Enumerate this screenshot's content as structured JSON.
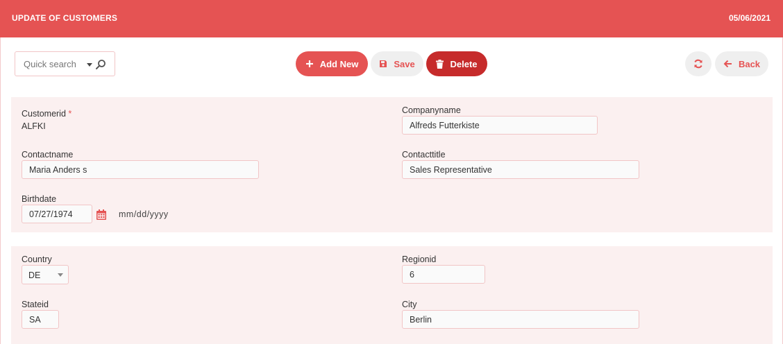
{
  "header": {
    "title": "UPDATE OF CUSTOMERS",
    "date": "05/06/2021"
  },
  "toolbar": {
    "search_placeholder": "Quick search",
    "add_label": "Add New",
    "save_label": "Save",
    "delete_label": "Delete",
    "back_label": "Back"
  },
  "colors": {
    "accent": "#e55353",
    "delete": "#c62b2b",
    "panel": "#fbf0f0"
  },
  "icons": {
    "search": "search-icon",
    "add": "plus-icon",
    "save": "floppy-disk-icon",
    "delete": "trash-icon",
    "refresh": "refresh-icon",
    "back": "arrow-left-icon",
    "calendar": "calendar-icon"
  },
  "form": {
    "customerid": {
      "label": "Customerid",
      "required_mark": "*",
      "value": "ALFKI"
    },
    "companyname": {
      "label": "Companyname",
      "value": "Alfreds Futterkiste"
    },
    "contactname": {
      "label": "Contactname",
      "value": "Maria Anders s"
    },
    "contacttitle": {
      "label": "Contacttitle",
      "value": "Sales Representative"
    },
    "birthdate": {
      "label": "Birthdate",
      "value": "07/27/1974",
      "format_hint": "mm/dd/yyyy"
    },
    "country": {
      "label": "Country",
      "value": "DE"
    },
    "regionid": {
      "label": "Regionid",
      "value": "6"
    },
    "stateid": {
      "label": "Stateid",
      "value": "SA"
    },
    "city": {
      "label": "City",
      "value": "Berlin"
    }
  }
}
